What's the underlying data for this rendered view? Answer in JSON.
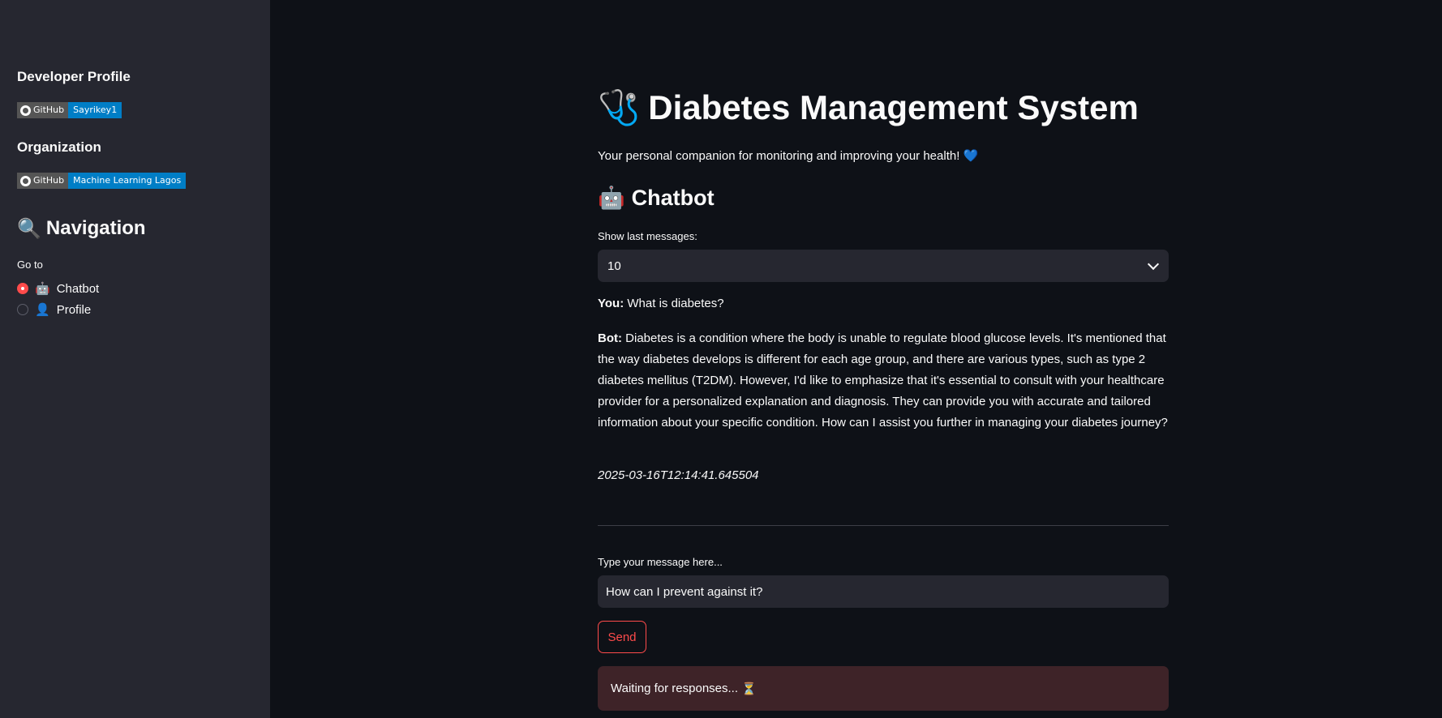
{
  "sidebar": {
    "developer_heading": "Developer Profile",
    "developer_badge": {
      "label": "GitHub",
      "value": "Sayrikey1"
    },
    "organization_heading": "Organization",
    "organization_badge": {
      "label": "GitHub",
      "value": "Machine Learning Lagos"
    },
    "navigation_icon": "🔍",
    "navigation_title": "Navigation",
    "goto_label": "Go to",
    "options": [
      {
        "icon": "🤖",
        "label": "Chatbot",
        "selected": true
      },
      {
        "icon": "👤",
        "label": "Profile",
        "selected": false
      }
    ]
  },
  "main": {
    "title_icon": "🩺",
    "title": "Diabetes Management System",
    "subtitle": "Your personal companion for monitoring and improving your health!",
    "subtitle_emoji": "💙",
    "section_icon": "🤖",
    "section_title": "Chatbot",
    "show_last_label": "Show last messages:",
    "show_last_value": "10",
    "messages": [
      {
        "speaker": "You:",
        "text": "What is diabetes?"
      },
      {
        "speaker": "Bot:",
        "text": "Diabetes is a condition where the body is unable to regulate blood glucose levels. It's mentioned that the way diabetes develops is different for each age group, and there are various types, such as type 2 diabetes mellitus (T2DM). However, I'd like to emphasize that it's essential to consult with your healthcare provider for a personalized explanation and diagnosis. They can provide you with accurate and tailored information about your specific condition. How can I assist you further in managing your diabetes journey?"
      }
    ],
    "timestamp": "2025-03-16T12:14:41.645504",
    "input_label": "Type your message here...",
    "input_value": "How can I prevent against it?",
    "send_label": "Send",
    "status_text": "Waiting for responses...",
    "status_emoji": "⏳"
  },
  "colors": {
    "accent": "#ff4b4b",
    "badge_value": "#007ec6",
    "sidebar_bg": "#262730",
    "main_bg": "#0e1117",
    "alert_bg": "#3e2328"
  }
}
